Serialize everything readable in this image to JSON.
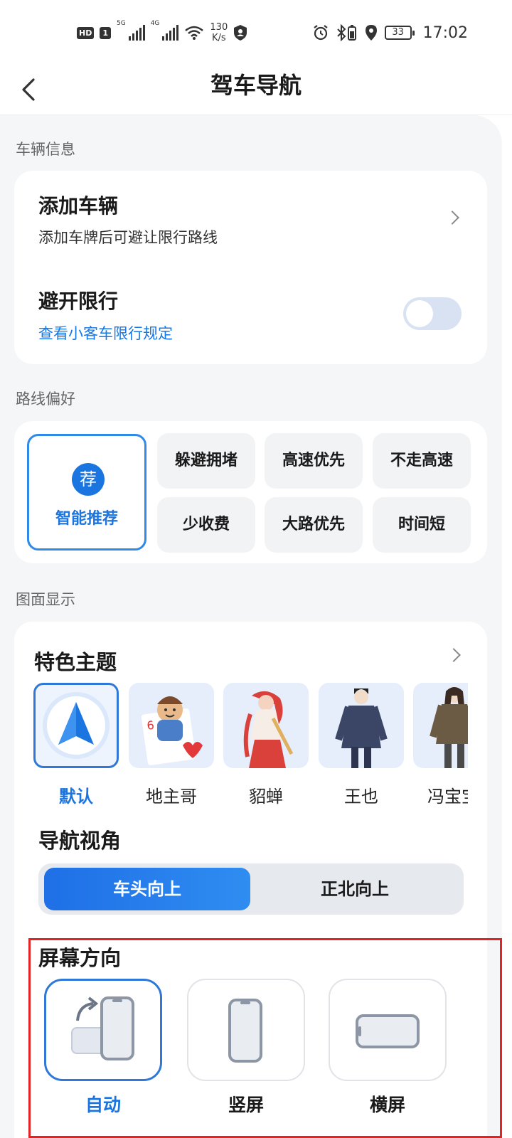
{
  "status_bar": {
    "hd": "HD",
    "sim": "1",
    "net1": "5G",
    "net2": "4G",
    "speed_value": "130",
    "speed_unit": "K/s",
    "battery": "33",
    "time": "17:02"
  },
  "header": {
    "title": "驾车导航"
  },
  "vehicle": {
    "section_label": "车辆信息",
    "add_title": "添加车辆",
    "add_sub": "添加车牌后可避让限行路线",
    "avoid_title": "避开限行",
    "avoid_link": "查看小客车限行规定",
    "avoid_enabled": false
  },
  "route": {
    "section_label": "路线偏好",
    "selected_badge": "荐",
    "selected_label": "智能推荐",
    "options": [
      "躲避拥堵",
      "高速优先",
      "不走高速",
      "少收费",
      "大路优先",
      "时间短"
    ]
  },
  "display": {
    "section_label": "图面显示",
    "theme_title": "特色主题",
    "themes": [
      "默认",
      "地主哥",
      "貂蝉",
      "王也",
      "冯宝宝"
    ],
    "view_title": "导航视角",
    "view_options": [
      "车头向上",
      "正北向上"
    ],
    "orientation_title": "屏幕方向",
    "orientations": [
      "自动",
      "竖屏",
      "横屏"
    ]
  },
  "colors": {
    "accent": "#1b75e0",
    "highlight": "#e02424"
  }
}
